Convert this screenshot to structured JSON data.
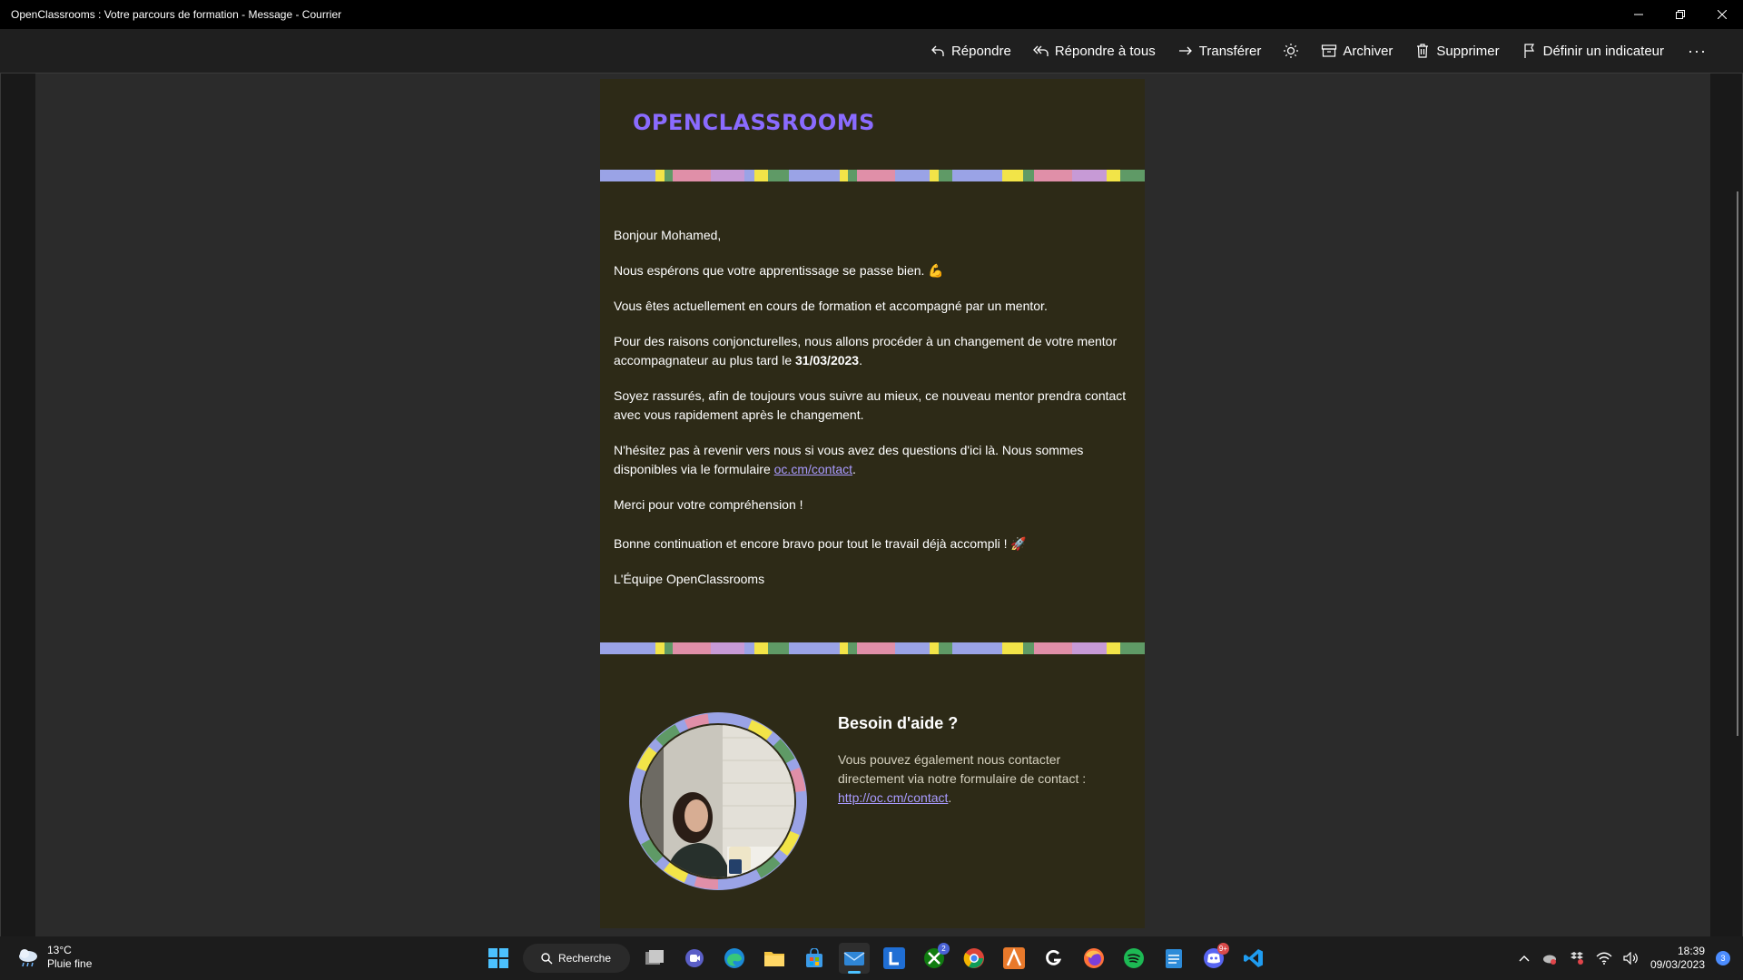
{
  "window": {
    "title": "OpenClassrooms : Votre parcours de formation - Message - Courrier",
    "minimize_icon": "minimize-icon",
    "restore_icon": "restore-icon",
    "close_icon": "close-icon"
  },
  "toolbar": {
    "reply": "Répondre",
    "reply_all": "Répondre à tous",
    "forward": "Transférer",
    "archive": "Archiver",
    "delete": "Supprimer",
    "flag": "Définir un indicateur",
    "more": "···"
  },
  "email": {
    "logo": "OPENCLASSROOMS",
    "brand_color": "#8a6bff",
    "background": "#2d2a17",
    "greeting": "Bonjour Mohamed,",
    "p1": "Nous espérons que votre apprentissage se passe bien. 💪",
    "p2": "Vous êtes actuellement en cours de formation et accompagné par un mentor.",
    "p3_before": "Pour des raisons conjoncturelles, nous allons procéder à un changement de votre mentor accompagnateur au plus tard le ",
    "p3_date": "31/03/2023",
    "p3_after": ".",
    "p4": "Soyez rassurés, afin de toujours vous suivre au mieux, ce nouveau mentor prendra contact avec vous rapidement après le changement.",
    "p5_before": "N'hésitez pas à revenir vers nous si vous avez des questions d'ici là. Nous sommes disponibles via le formulaire ",
    "p5_link": "oc.cm/contact",
    "p5_after": ".",
    "p6": "Merci pour votre compréhension !",
    "p7": "Bonne continuation et encore bravo pour tout le travail déjà accompli ! 🚀",
    "signature": "L'Équipe OpenClassrooms",
    "help_title": "Besoin d'aide ?",
    "help_text": "Vous pouvez également nous contacter directement via notre formulaire de contact : ",
    "help_link": "http://oc.cm/contact",
    "help_after": "."
  },
  "taskbar": {
    "weather_temp": "13°C",
    "weather_desc": "Pluie fine",
    "search_label": "Recherche",
    "xbox_badge": "2",
    "discord_badge": "9+",
    "time": "18:39",
    "date": "09/03/2023",
    "notification_count": "3"
  }
}
